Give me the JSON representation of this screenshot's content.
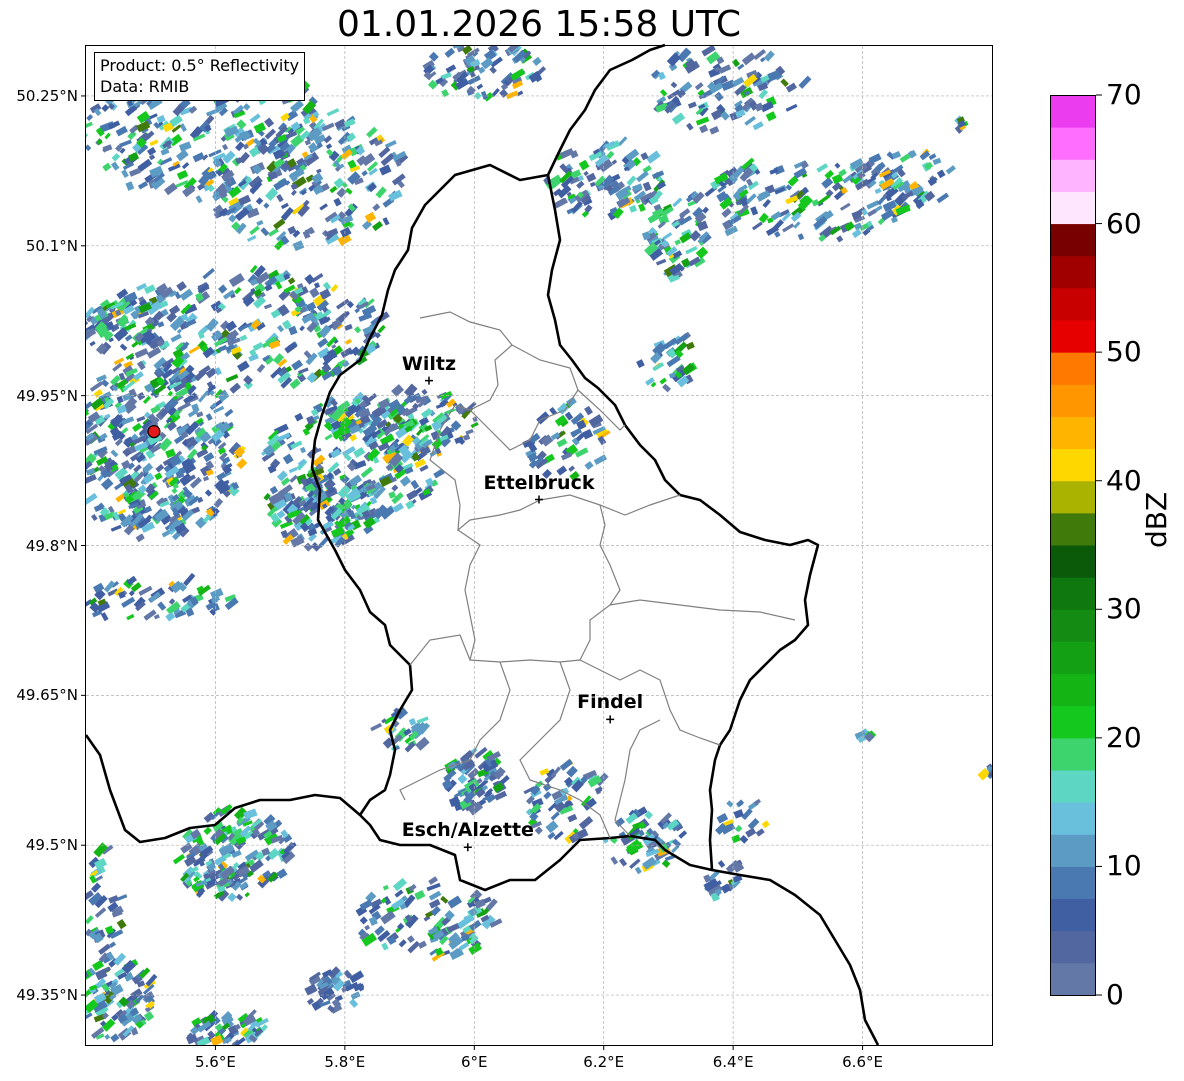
{
  "title": "01.01.2026 15:58 UTC",
  "info": {
    "product": "Product: 0.5° Reflectivity",
    "data": "Data: RMIB"
  },
  "map": {
    "lon_range": [
      5.4,
      6.8
    ],
    "lat_range": [
      49.3,
      50.3
    ],
    "lat_ticks": [
      {
        "value": 50.25,
        "label": "50.25°N"
      },
      {
        "value": 50.1,
        "label": "50.1°N"
      },
      {
        "value": 49.95,
        "label": "49.95°N"
      },
      {
        "value": 49.8,
        "label": "49.8°N"
      },
      {
        "value": 49.65,
        "label": "49.65°N"
      },
      {
        "value": 49.5,
        "label": "49.5°N"
      },
      {
        "value": 49.35,
        "label": "49.35°N"
      }
    ],
    "lon_ticks": [
      {
        "value": 5.6,
        "label": "5.6°E"
      },
      {
        "value": 5.8,
        "label": "5.8°E"
      },
      {
        "value": 6.0,
        "label": "6°E"
      },
      {
        "value": 6.2,
        "label": "6.2°E"
      },
      {
        "value": 6.4,
        "label": "6.4°E"
      },
      {
        "value": 6.6,
        "label": "6.6°E"
      }
    ],
    "gridlines": true,
    "cities": [
      {
        "name": "Wiltz",
        "lon": 5.93,
        "lat": 49.965
      },
      {
        "name": "Ettelbruck",
        "lon": 6.1,
        "lat": 49.846
      },
      {
        "name": "Findel",
        "lon": 6.21,
        "lat": 49.626
      },
      {
        "name": "Esch/Alzette",
        "lon": 5.99,
        "lat": 49.498
      }
    ],
    "radar_site": {
      "lon": 5.505,
      "lat": 49.914,
      "color": "#e31a1c"
    }
  },
  "colorbar": {
    "label": "dBZ",
    "vmin": 0,
    "vmax": 70,
    "ticks": [
      0,
      10,
      20,
      30,
      40,
      50,
      60,
      70
    ],
    "colors": [
      "#6478a8",
      "#5267a0",
      "#405ea2",
      "#4a78b0",
      "#5c9cc4",
      "#68c0dc",
      "#5dd6c4",
      "#3dd46e",
      "#14c81e",
      "#14b414",
      "#14a014",
      "#148c14",
      "#0f780f",
      "#0a5a0a",
      "#3f7a0a",
      "#aab400",
      "#ffd700",
      "#ffb400",
      "#ff9600",
      "#ff7800",
      "#e60000",
      "#c80000",
      "#a00000",
      "#780000",
      "#ffe6ff",
      "#ffb4ff",
      "#ff6eff",
      "#eb3cf0"
    ]
  }
}
